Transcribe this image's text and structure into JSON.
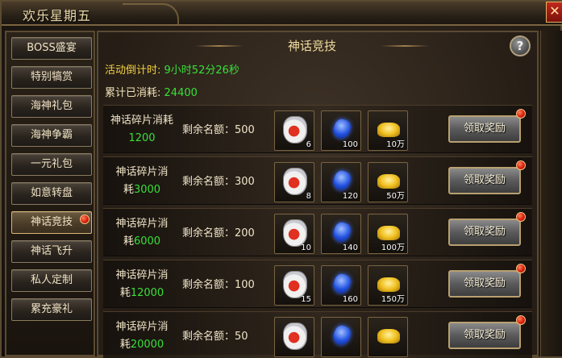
{
  "window": {
    "title": "欢乐星期五",
    "close_icon": "close-icon"
  },
  "sidebar": {
    "items": [
      {
        "label": "BOSS盛宴"
      },
      {
        "label": "特别犒赏"
      },
      {
        "label": "海神礼包"
      },
      {
        "label": "海神争霸"
      },
      {
        "label": "一元礼包"
      },
      {
        "label": "如意转盘"
      },
      {
        "label": "神话竞技",
        "active": true
      },
      {
        "label": "神话飞升"
      },
      {
        "label": "私人定制"
      },
      {
        "label": "累充豪礼"
      }
    ]
  },
  "main": {
    "title": "神话竞技",
    "countdown_label": "活动倒计时:",
    "countdown_value": "9小时52分26秒",
    "spent_label": "累计已消耗:",
    "spent_value": "24400",
    "rows": [
      {
        "title": "神话碎片消耗",
        "cost_prefix": "耗",
        "cost": "1200",
        "remain": "剩余名额：500",
        "items": [
          "6",
          "100",
          "10万"
        ],
        "claim": "领取奖励"
      },
      {
        "title": "神话碎片消",
        "cost_prefix": "耗",
        "cost": "3000",
        "remain": "剩余名额：300",
        "items": [
          "8",
          "120",
          "50万"
        ],
        "claim": "领取奖励"
      },
      {
        "title": "神话碎片消",
        "cost_prefix": "耗",
        "cost": "6000",
        "remain": "剩余名额：200",
        "items": [
          "10",
          "140",
          "100万"
        ],
        "claim": "领取奖励"
      },
      {
        "title": "神话碎片消",
        "cost_prefix": "耗",
        "cost": "12000",
        "remain": "剩余名额：100",
        "items": [
          "15",
          "160",
          "150万"
        ],
        "claim": "领取奖励"
      },
      {
        "title": "神话碎片消",
        "cost_prefix": "耗",
        "cost": "20000",
        "remain": "剩余名额：50",
        "items": [
          "",
          "",
          ""
        ],
        "claim": "领取奖励"
      }
    ]
  },
  "help": {
    "label": "?"
  },
  "colors": {
    "accent_green": "#38e038",
    "gold": "#f0dca0",
    "red_dot": "#d8200c"
  }
}
